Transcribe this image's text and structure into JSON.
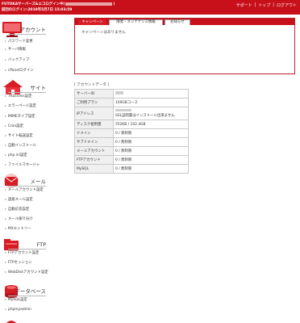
{
  "topbar": {
    "line1_prefix": "FUTOKAサーバーズ",
    "line1_mid": "&エコログイン中(",
    "line1_suffix": ")",
    "line2": "前回のログイン:2019年5月7日 15:03:59",
    "nav": [
      "サポート",
      "トップ",
      "ログアウト"
    ],
    "bg_color": "#c8101a"
  },
  "sidebar": {
    "sections": [
      {
        "title": "アカウント",
        "icon": "monitor-icon",
        "items": [
          "パスワード変更",
          "サーバ情報",
          "バックアップ",
          "cPanelログイン"
        ]
      },
      {
        "title": "サイト",
        "icon": "house-icon",
        "items": [
          ".htaccess設定",
          "エラーページ設定",
          "MIMEタイプ設定",
          "Cron設定",
          "サイト転送設定",
          "自動インストール",
          "php.ini設定",
          "ファイルマネージャ"
        ]
      },
      {
        "title": "メール",
        "icon": "envelope-icon",
        "items": [
          "メールアカウント設定",
          "迷惑メール設定",
          "自動応答設定",
          "メール振り分け",
          "MXエントリー"
        ]
      },
      {
        "title": "FTP",
        "icon": "ftp-folder-icon",
        "items": [
          "FTPアカウント設定",
          "FTPセッション",
          "WebDiskアカウント設定"
        ]
      },
      {
        "title": "データベース",
        "icon": "database-icon",
        "items": [
          "MySQL設定",
          "phpmyadmin"
        ]
      }
    ]
  },
  "tabs": [
    "キャンペーン",
    "障害・メンテナンス情報",
    "お知らせ"
  ],
  "notice": "キャンペーンはありません",
  "account": {
    "heading": "[ アカウントデータ ]",
    "rows": [
      {
        "key": "サーバーID",
        "value": ""
      },
      {
        "key": "ご利用プラン",
        "value": "100GBコース"
      },
      {
        "key": "IPアドレス",
        "value": "SSL証明書はインストール出来ません"
      },
      {
        "key": "ディスク使用量",
        "value": "552KB / 102.4GB"
      },
      {
        "key": "ドメイン",
        "value": "0 / 無制限"
      },
      {
        "key": "サブドメイン",
        "value": "0 / 無制限"
      },
      {
        "key": "メールアカウント",
        "value": "0 / 無制限"
      },
      {
        "key": "FTPアカウント",
        "value": "0 / 無制限"
      },
      {
        "key": "MySQL",
        "value": "0 / 無制限"
      }
    ]
  }
}
